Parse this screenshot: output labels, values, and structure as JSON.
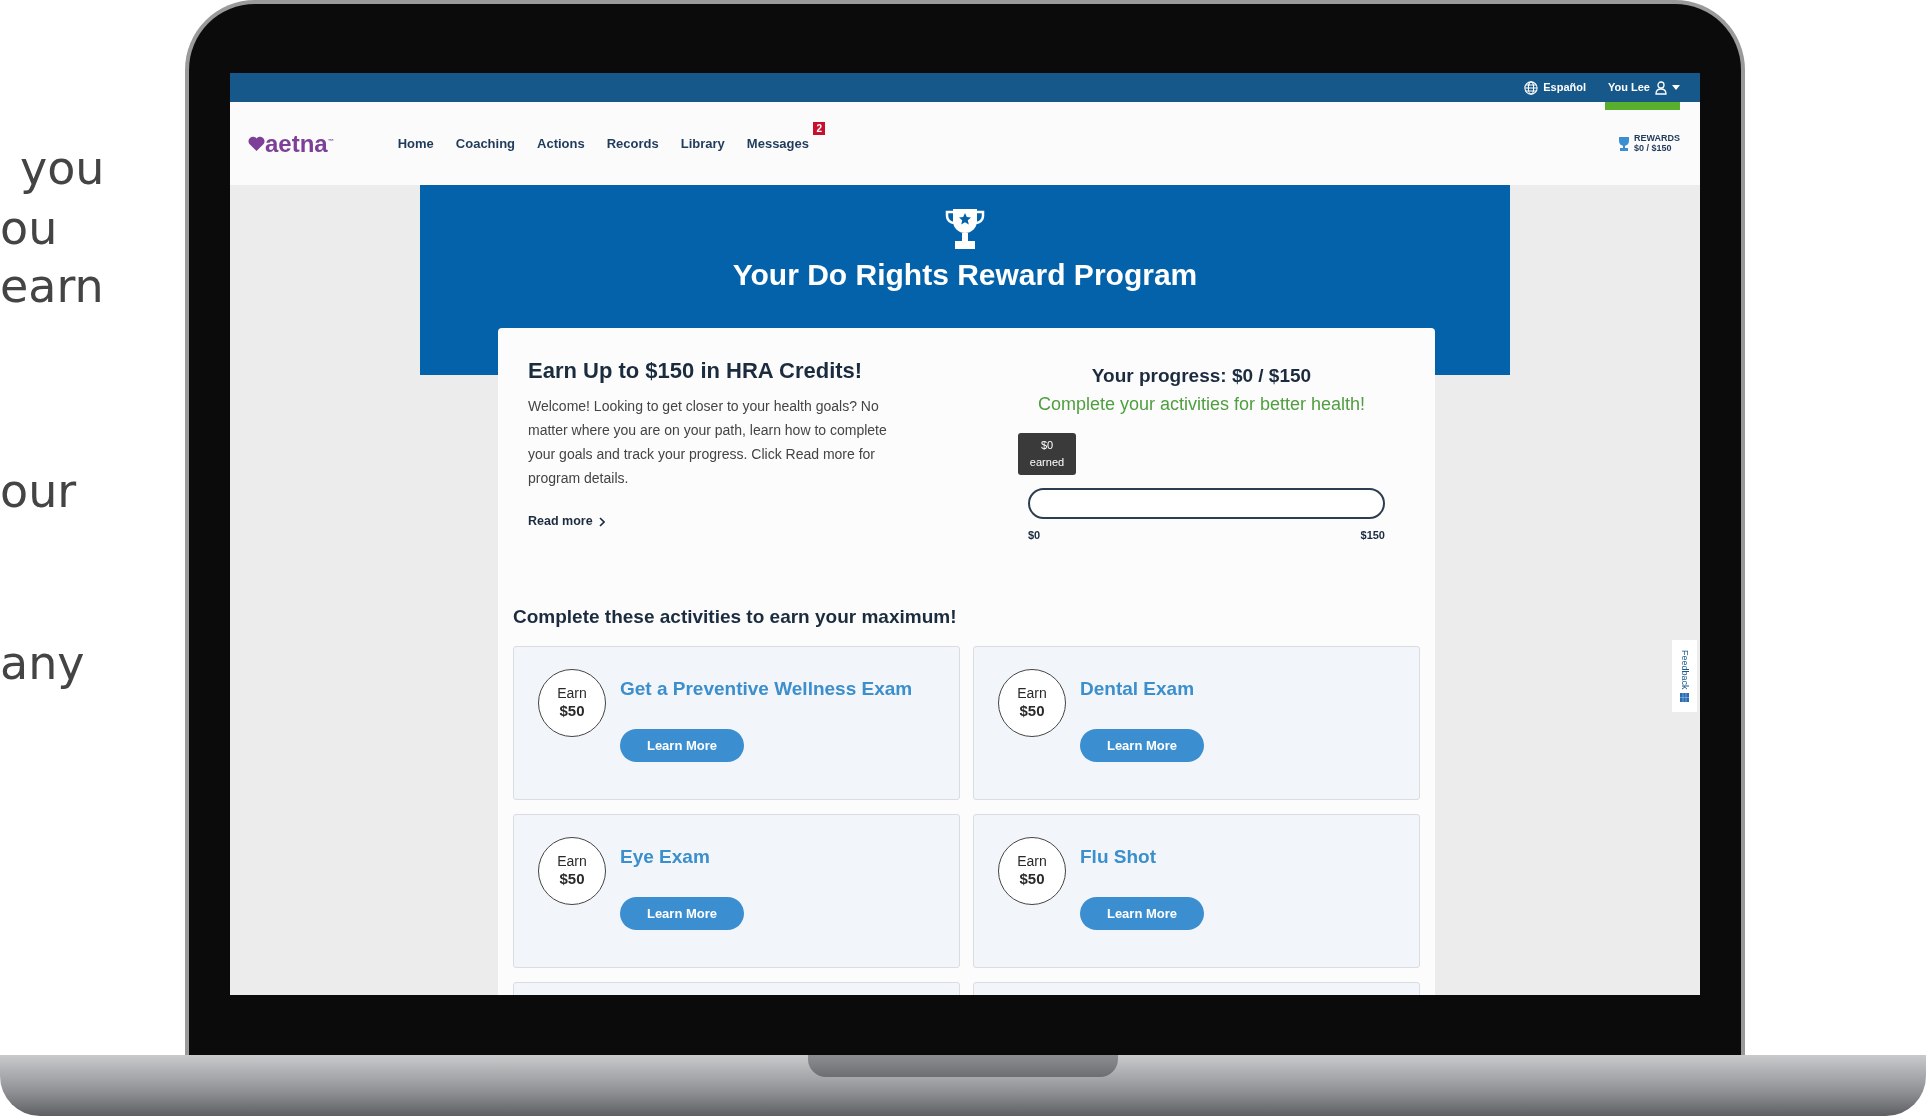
{
  "side_text": [
    "you",
    "ou",
    "earn",
    "our",
    "any"
  ],
  "top_bar": {
    "language": "Español",
    "user": "You Lee"
  },
  "nav": {
    "logo": "aetna",
    "trademark": "™",
    "items": [
      {
        "label": "Home"
      },
      {
        "label": "Coaching"
      },
      {
        "label": "Actions"
      },
      {
        "label": "Records"
      },
      {
        "label": "Library"
      },
      {
        "label": "Messages",
        "badge": "2"
      }
    ],
    "rewards": {
      "label": "REWARDS",
      "amount": "$0 / $150"
    }
  },
  "hero": {
    "title": "Your Do Rights Reward Program"
  },
  "intro": {
    "title": "Earn Up to $150 in HRA Credits!",
    "text": "Welcome! Looking to get closer to your health goals? No matter where you are on your path, learn how to complete your goals and track your progress. Click Read more for program details.",
    "read_more": "Read more"
  },
  "progress": {
    "title": "Your progress: $0 / $150",
    "subtitle": "Complete your activities for better health!",
    "tooltip": [
      "$0",
      "earned"
    ],
    "level": 0,
    "min_label": "$0",
    "max_label": "$150"
  },
  "activities_heading": "Complete these activities to earn your maximum!",
  "activities": [
    {
      "earn": "Earn",
      "amount": "$50",
      "title": "Get a Preventive Wellness Exam",
      "button": "Learn More"
    },
    {
      "earn": "Earn",
      "amount": "$50",
      "title": "Dental Exam",
      "button": "Learn More"
    },
    {
      "earn": "Earn",
      "amount": "$50",
      "title": "Eye Exam",
      "button": "Learn More"
    },
    {
      "earn": "Earn",
      "amount": "$50",
      "title": "Flu Shot",
      "button": "Learn More"
    }
  ],
  "feedback": "Feedback"
}
